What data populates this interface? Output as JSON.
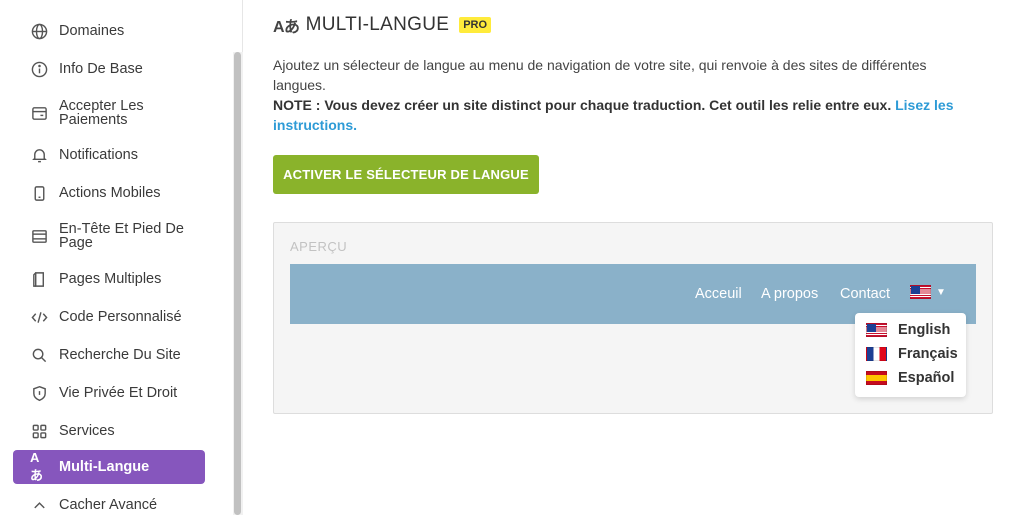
{
  "sidebar": {
    "items": [
      {
        "label": "Domaines",
        "icon": "globe-icon"
      },
      {
        "label": "Info De Base",
        "icon": "info-icon"
      },
      {
        "label": "Accepter Les Paiements",
        "icon": "payment-icon"
      },
      {
        "label": "Notifications",
        "icon": "bell-icon"
      },
      {
        "label": "Actions Mobiles",
        "icon": "mobile-icon"
      },
      {
        "label": "En-Tête Et Pied De Page",
        "icon": "header-footer-icon"
      },
      {
        "label": "Pages Multiples",
        "icon": "pages-icon"
      },
      {
        "label": "Code Personnalisé",
        "icon": "code-icon"
      },
      {
        "label": "Recherche Du Site",
        "icon": "search-icon"
      },
      {
        "label": "Vie Privée Et Droit",
        "icon": "shield-icon"
      },
      {
        "label": "Services",
        "icon": "grid-icon"
      },
      {
        "label": "Multi-Langue",
        "icon": "translate-icon",
        "icon_text": "Aあ",
        "active": true
      },
      {
        "label": "Cacher Avancé",
        "icon": "chevron-up-icon"
      }
    ]
  },
  "main": {
    "title_icon": "Aあ",
    "title": "MULTI-LANGUE",
    "badge": "PRO",
    "description": "Ajoutez un sélecteur de langue au menu de navigation de votre site, qui renvoie à des sites de différentes langues.",
    "note_strong": "NOTE : Vous devez créer un site distinct pour chaque traduction. Cet outil les relie entre eux.",
    "note_link": "Lisez les instructions.",
    "button_label": "ACTIVER LE SÉLECTEUR DE LANGUE",
    "preview": {
      "label": "APERÇU",
      "nav_links": [
        "Acceuil",
        "A propos",
        "Contact"
      ],
      "languages": [
        {
          "label": "English",
          "flag": "us-flag-icon"
        },
        {
          "label": "Français",
          "flag": "fr-flag-icon"
        },
        {
          "label": "Español",
          "flag": "es-flag-icon"
        }
      ]
    }
  },
  "colors": {
    "accent": "#8656bd",
    "button": "#8ab32b",
    "preview_nav": "#8ab1c9",
    "badge": "#ffeb3b",
    "link": "#2e9bd6"
  }
}
